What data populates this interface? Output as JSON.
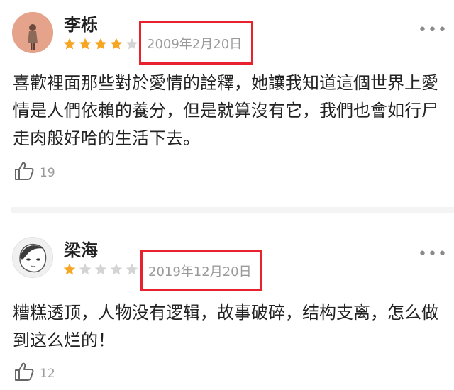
{
  "reviews": [
    {
      "user": "李栎",
      "rating": 4,
      "date": "2009年2月20日",
      "text": "喜歡裡面那些對於愛情的詮釋，她讓我知道這個世界上愛情是人們依賴的養分，但是就算沒有它，我們也會如行尸走肉般好哈的生活下去。",
      "likes": "19"
    },
    {
      "user": "梁海",
      "rating": 1,
      "date": "2019年12月20日",
      "text": "糟糕透顶，人物没有逻辑，故事破碎，结构支离，怎么做到这么烂的！",
      "likes": "12"
    }
  ],
  "more_glyph": "•••",
  "colors": {
    "star_on": "#f6a623",
    "star_off": "#d4d4d4",
    "highlight": "#e8222c"
  },
  "icons": {
    "like": "thumbs-up-icon",
    "more": "more-dots-icon"
  }
}
